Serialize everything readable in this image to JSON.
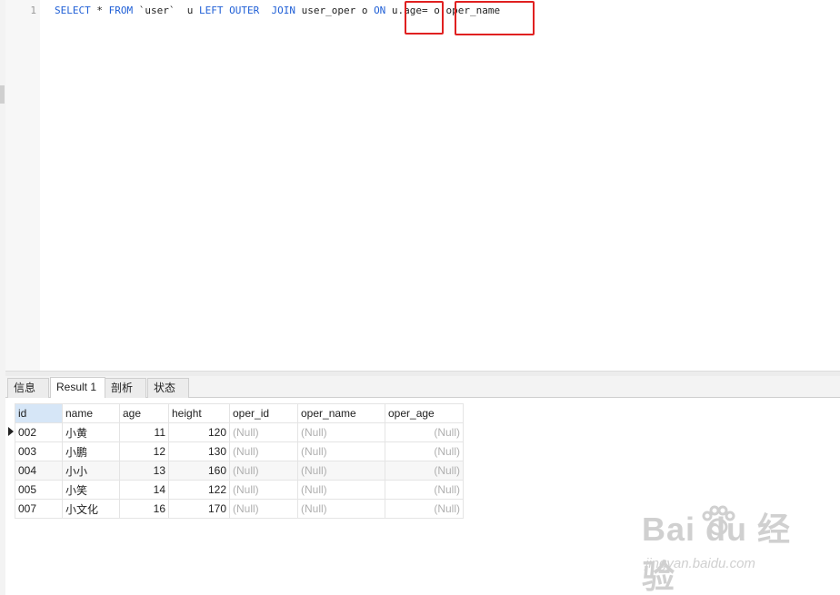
{
  "editor": {
    "line_number": "1",
    "sql": {
      "kw_select": "SELECT",
      "t_star": " * ",
      "kw_from": "FROM",
      "t_user": " `user`  u ",
      "kw_left_outer": "LEFT OUTER",
      "t_sp": "  ",
      "kw_join": "JOIN",
      "t_user_oper": " user_oper o ",
      "kw_on": "ON",
      "t_cond": " u.age= o.oper_name"
    }
  },
  "tabs": [
    "信息",
    "Result 1",
    "剖析",
    "状态"
  ],
  "active_tab": "Result 1",
  "result": {
    "columns": [
      "id",
      "name",
      "age",
      "height",
      "oper_id",
      "oper_name",
      "oper_age"
    ],
    "rows": [
      [
        "002",
        "小黄",
        "11",
        "120",
        "(Null)",
        "(Null)",
        "(Null)"
      ],
      [
        "003",
        "小鹏",
        "12",
        "130",
        "(Null)",
        "(Null)",
        "(Null)"
      ],
      [
        "004",
        "小小",
        "13",
        "160",
        "(Null)",
        "(Null)",
        "(Null)"
      ],
      [
        "005",
        "小笑",
        "14",
        "122",
        "(Null)",
        "(Null)",
        "(Null)"
      ],
      [
        "007",
        "小文化",
        "16",
        "170",
        "(Null)",
        "(Null)",
        "(Null)"
      ]
    ]
  },
  "watermark": {
    "brand": "Bai  du 经验",
    "url": "jingyan.baidu.com"
  },
  "colors": {
    "keyword": "#1f5fd6",
    "highlight_box": "#e02020",
    "null_text": "#b0b0b0",
    "selected_header": "#d6e6f7"
  }
}
